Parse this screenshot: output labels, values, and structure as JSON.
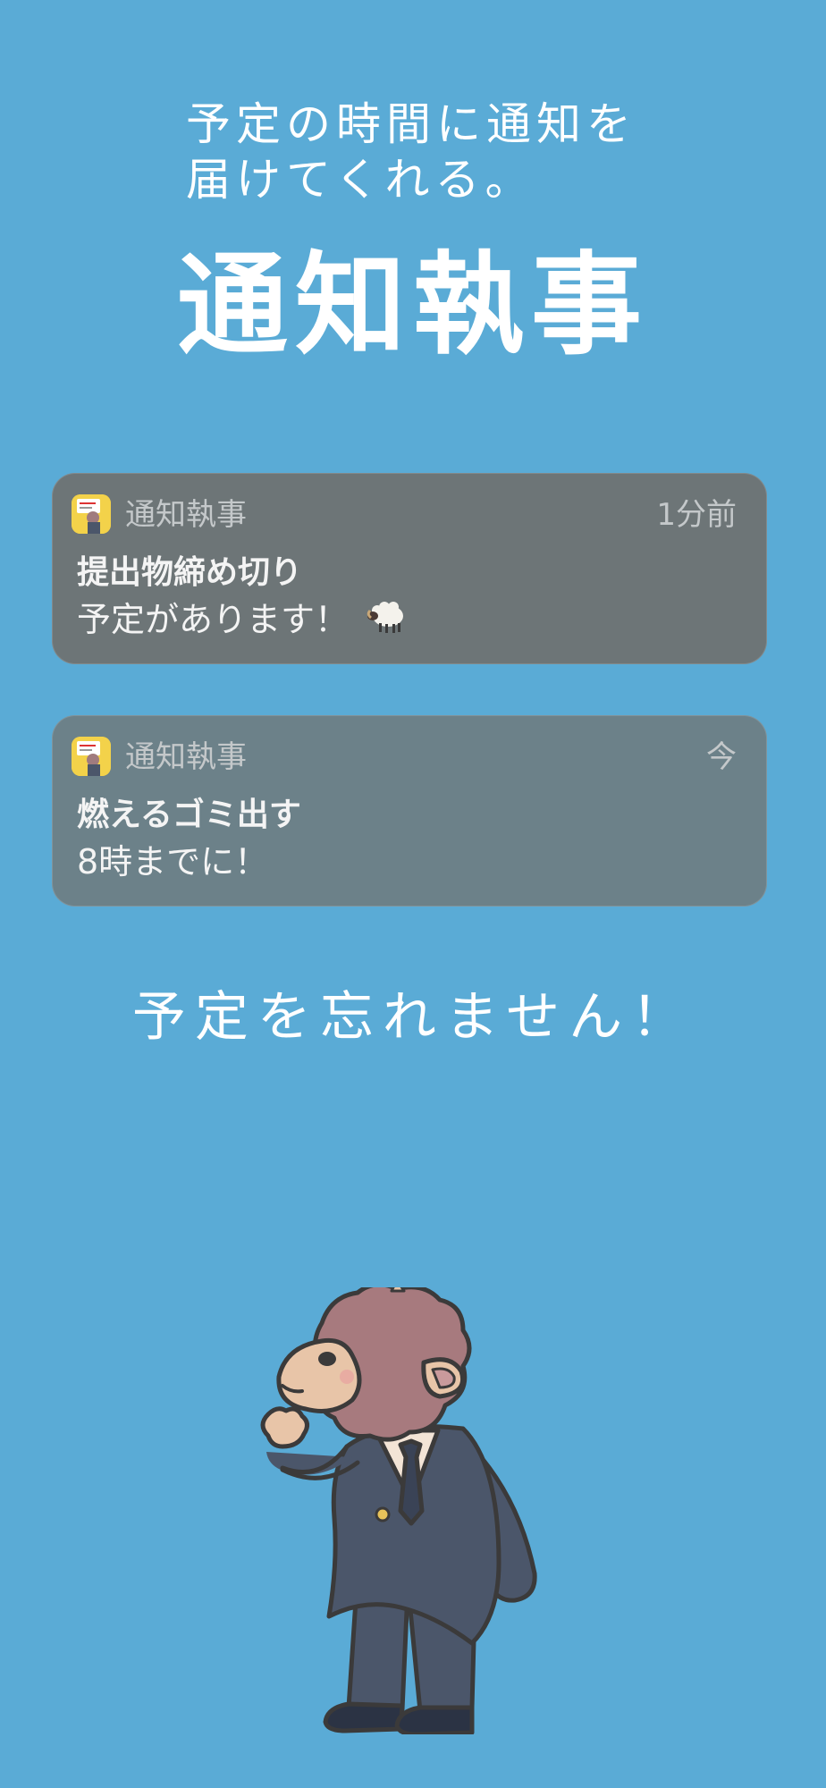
{
  "header": {
    "tagline_line1": "予定の時間に通知を",
    "tagline_line2": "届けてくれる。",
    "app_title": "通知執事"
  },
  "notifications": [
    {
      "app_name": "通知執事",
      "time": "1分前",
      "title": "提出物締め切り",
      "body": "予定があります！",
      "emoji": "sheep-emoji"
    },
    {
      "app_name": "通知執事",
      "time": "今",
      "title": "燃えるゴミ出す",
      "body": "8時までに！"
    }
  ],
  "footer": {
    "subtitle": "予定を忘れません！"
  },
  "colors": {
    "background": "#5aabd6",
    "notification_1": "#6d7577",
    "notification_2": "#6c8189",
    "app_icon": "#f3d24a"
  },
  "illustration": "butler-sheep-mascot"
}
